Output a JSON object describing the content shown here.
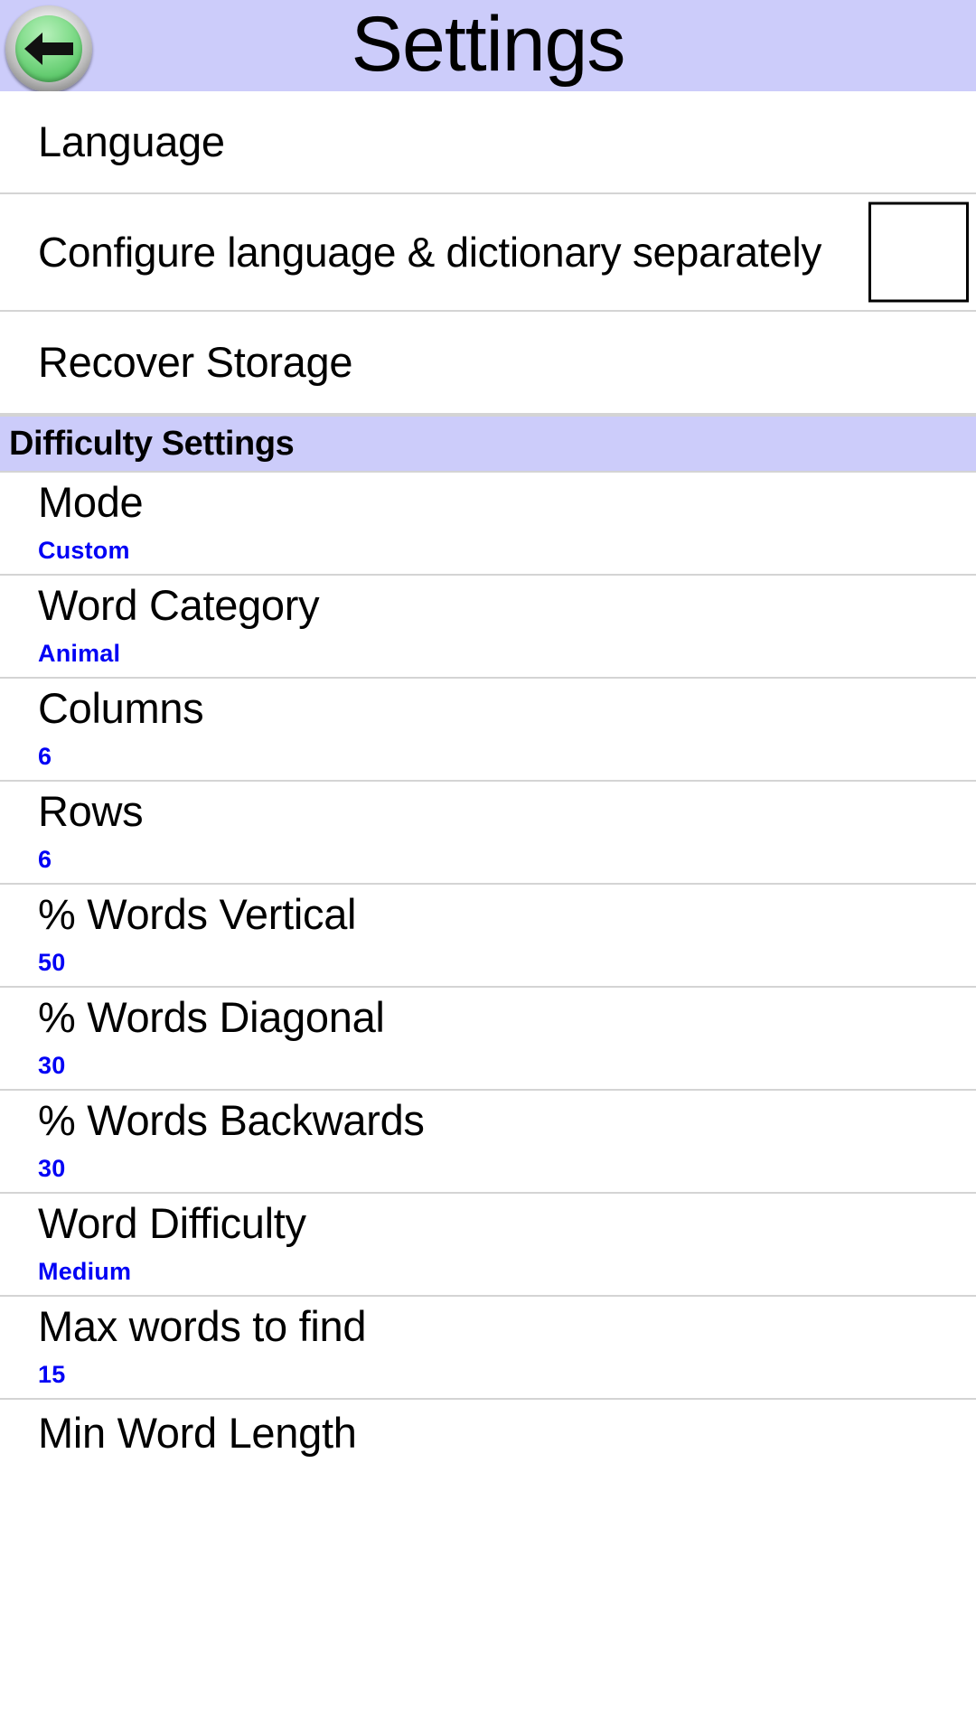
{
  "header": {
    "title": "Settings",
    "back_icon": "back-arrow-icon"
  },
  "general_section": {
    "rows": [
      {
        "title": "Language",
        "value": "",
        "type": "plain"
      },
      {
        "title": "Configure language & dictionary separately",
        "value": "",
        "type": "checkbox",
        "checked": false
      },
      {
        "title": "Recover Storage",
        "value": "",
        "type": "plain"
      }
    ]
  },
  "difficulty_section": {
    "header": "Difficulty Settings",
    "rows": [
      {
        "title": "Mode",
        "value": "Custom"
      },
      {
        "title": "Word Category",
        "value": "Animal"
      },
      {
        "title": "Columns",
        "value": "6"
      },
      {
        "title": "Rows",
        "value": "6"
      },
      {
        "title": "% Words Vertical",
        "value": "50"
      },
      {
        "title": "% Words Diagonal",
        "value": "30"
      },
      {
        "title": "% Words Backwards",
        "value": "30"
      },
      {
        "title": "Word Difficulty",
        "value": "Medium"
      },
      {
        "title": "Max words to find",
        "value": "15"
      },
      {
        "title": "Min Word Length",
        "value": ""
      }
    ]
  },
  "colors": {
    "header_background": "#ccccfa",
    "value_text": "#0000f5",
    "row_background": "#ffffff",
    "divider": "#d4d4d4",
    "back_button_green": "#84dd8d"
  }
}
